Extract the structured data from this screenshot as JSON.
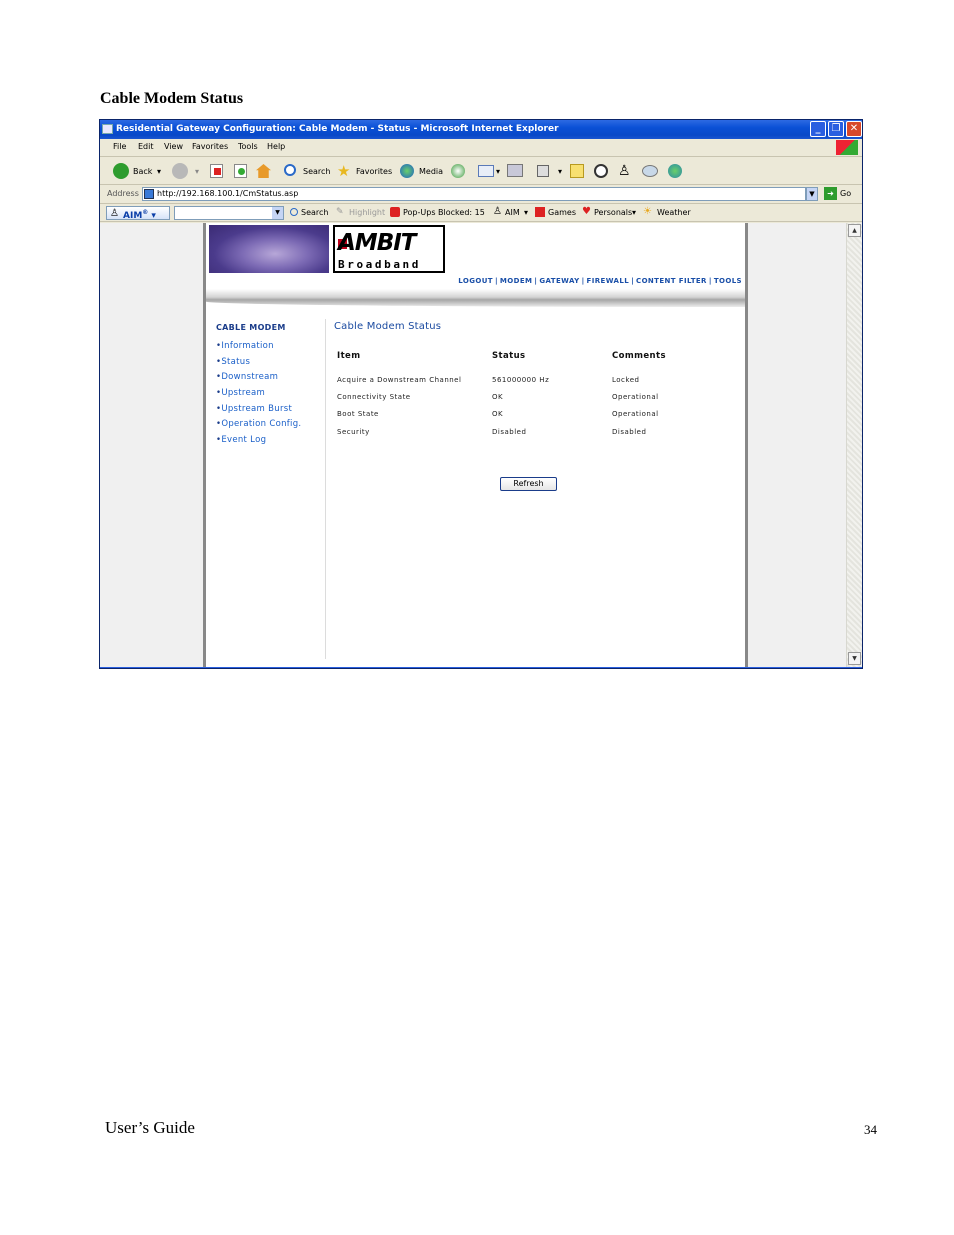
{
  "document": {
    "heading": "Cable Modem Status",
    "footer_left": "User’s Guide",
    "page_number": "34"
  },
  "browser": {
    "title": "Residential Gateway Configuration: Cable Modem - Status - Microsoft Internet Explorer",
    "menu": [
      "File",
      "Edit",
      "View",
      "Favorites",
      "Tools",
      "Help"
    ],
    "toolbar": {
      "back": "Back",
      "search": "Search",
      "favorites": "Favorites",
      "media": "Media"
    },
    "address_label": "Address",
    "address_url": "http://192.168.100.1/CmStatus.asp",
    "go_label": "Go",
    "aim_bar": {
      "aim_label": "AIM",
      "search": "Search",
      "highlight": "Highlight",
      "popups": "Pop-Ups Blocked: 15",
      "aim": "AIM",
      "games": "Games",
      "personals": "Personals",
      "weather": "Weather"
    }
  },
  "page": {
    "logo_main": "AMBIT",
    "logo_sub": "Broadband",
    "nav": [
      "LOGOUT",
      "MODEM",
      "GATEWAY",
      "FIREWALL",
      "CONTENT FILTER",
      "TOOLS"
    ],
    "sidebar_title": "CABLE MODEM",
    "sidebar_items": [
      "Information",
      "Status",
      "Downstream",
      "Upstream",
      "Upstream Burst",
      "Operation Config.",
      "Event Log"
    ],
    "main_title": "Cable Modem Status",
    "table": {
      "headers": [
        "Item",
        "Status",
        "Comments"
      ],
      "rows": [
        [
          "Acquire a Downstream Channel",
          "561000000 Hz",
          "Locked"
        ],
        [
          "Connectivity State",
          "OK",
          "Operational"
        ],
        [
          "Boot State",
          "OK",
          "Operational"
        ],
        [
          "Security",
          "Disabled",
          "Disabled"
        ]
      ]
    },
    "refresh_label": "Refresh"
  }
}
